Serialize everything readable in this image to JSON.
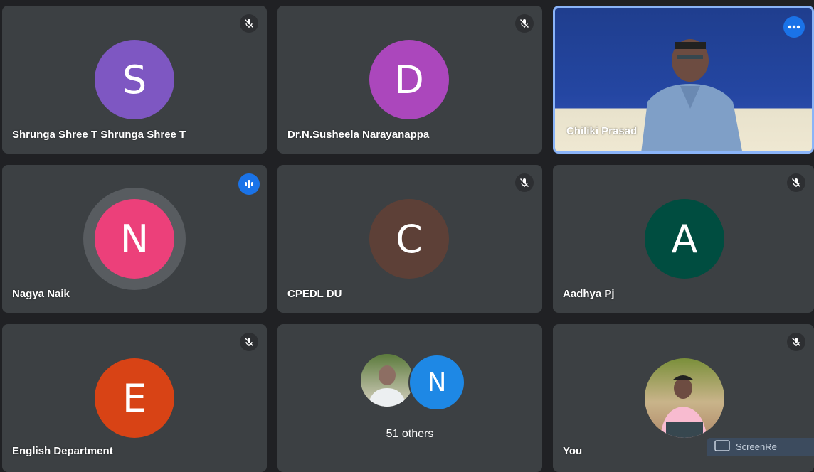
{
  "participants": [
    {
      "id": "t1",
      "name": "Shrunga Shree T Shrunga Shree T",
      "initial": "S",
      "color": "#7e57c2",
      "muted": true
    },
    {
      "id": "t2",
      "name": "Dr.N.Susheela Narayanappa",
      "initial": "D",
      "color": "#ab47bc",
      "muted": true
    },
    {
      "id": "t3",
      "name": "Chiliki Prasad",
      "initial": "",
      "color": "",
      "muted": false,
      "video": true,
      "pinned_menu": true
    },
    {
      "id": "t4",
      "name": "Nagya Naik",
      "initial": "N",
      "color": "#ec407a",
      "muted": false,
      "speaking": true
    },
    {
      "id": "t5",
      "name": "CPEDL DU",
      "initial": "C",
      "color": "#5d4037",
      "muted": true
    },
    {
      "id": "t6",
      "name": "Aadhya Pj",
      "initial": "A",
      "color": "#004d40",
      "muted": true
    },
    {
      "id": "t7",
      "name": "English Department",
      "initial": "E",
      "color": "#d84315",
      "muted": true
    },
    {
      "id": "t8",
      "name": "",
      "others_label": "51 others",
      "initial": "N",
      "color": "#1e88e5",
      "muted": false
    },
    {
      "id": "t9",
      "name": "You",
      "initial": "",
      "color": "",
      "muted": true,
      "photo": true
    }
  ],
  "screen_share": {
    "label": "ScreenRe"
  },
  "icons": {
    "mute": "mic-off-icon",
    "speaking": "audio-level-icon",
    "more": "more-options-icon"
  }
}
